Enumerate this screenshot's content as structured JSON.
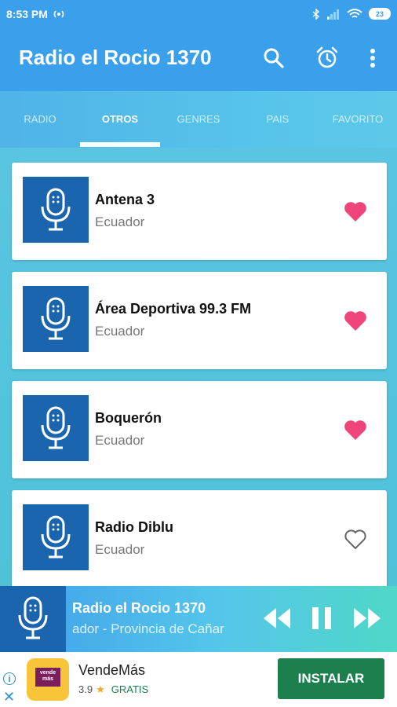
{
  "status_bar": {
    "time": "8:53 PM",
    "battery": "23"
  },
  "app_bar": {
    "title": "Radio el Rocio 1370"
  },
  "tabs": [
    {
      "label": "RADIO",
      "active": false
    },
    {
      "label": "OTROS",
      "active": true
    },
    {
      "label": "GENRES",
      "active": false
    },
    {
      "label": "PAIS",
      "active": false
    },
    {
      "label": "FAVORITO",
      "active": false
    }
  ],
  "stations": [
    {
      "name": "Antena 3",
      "country": "Ecuador",
      "favorite": true
    },
    {
      "name": "Área Deportiva 99.3 FM",
      "country": "Ecuador",
      "favorite": true
    },
    {
      "name": "Boquerón",
      "country": "Ecuador",
      "favorite": true
    },
    {
      "name": "Radio Diblu",
      "country": "Ecuador",
      "favorite": false
    }
  ],
  "player": {
    "title": "Radio el Rocio 1370",
    "subtitle": "ador - Provincia de Cañar"
  },
  "ad": {
    "app_name": "VendeMás",
    "rating": "3.9",
    "price": "GRATIS",
    "cta": "INSTALAR",
    "logo_text": "vende más"
  },
  "colors": {
    "primary": "#3aa0ec",
    "heart": "#f0457a",
    "art": "#1a65ad",
    "install": "#1b7f4e"
  }
}
